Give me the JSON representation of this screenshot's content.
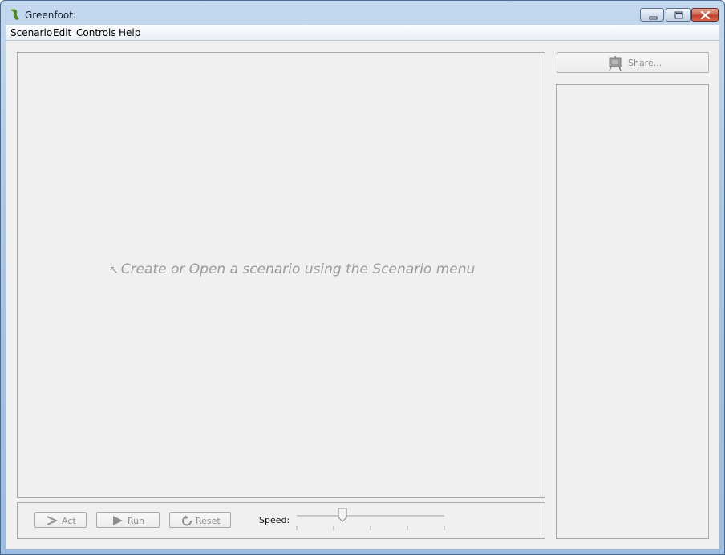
{
  "window": {
    "title": "Greenfoot:",
    "icons": {
      "app": "greenfoot-foot-icon",
      "minimize": "minimize-icon",
      "maximize": "maximize-icon",
      "close": "close-icon"
    }
  },
  "menubar": {
    "items": [
      {
        "label": "Scenario"
      },
      {
        "label": "Edit"
      },
      {
        "label": "Controls"
      },
      {
        "label": "Help"
      }
    ]
  },
  "world": {
    "hint_arrow": "↖",
    "hint": "Create or Open a scenario using the Scenario menu"
  },
  "controls": {
    "act_label": "Act",
    "run_label": "Run",
    "reset_label": "Reset",
    "speed_label": "Speed:",
    "speed_value_percent": 31,
    "enabled": false
  },
  "share": {
    "label": "Share...",
    "icon": "easel-icon",
    "enabled": false
  },
  "colors": {
    "panel_bg": "#f0f0f0",
    "disabled_text": "#8e8e8e",
    "title_blue": "#a9c6e6",
    "close_red": "#c0412c"
  }
}
